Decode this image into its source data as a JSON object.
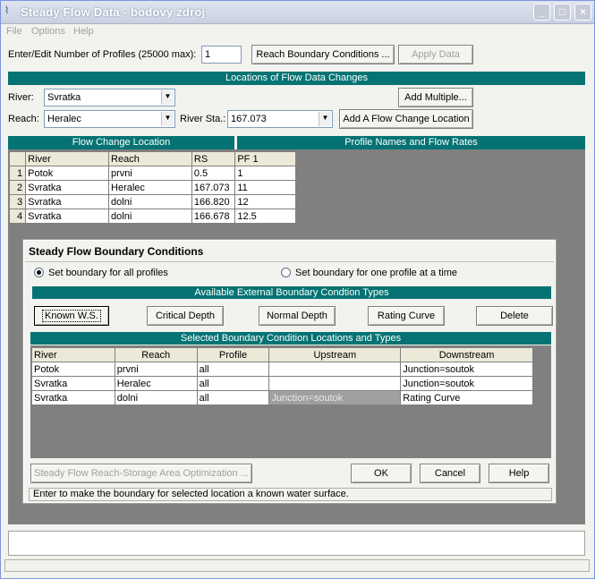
{
  "window": {
    "title": "Steady Flow Data - bodovy zdroj",
    "controls": {
      "minimize": "_",
      "maximize": "□",
      "close": "×"
    }
  },
  "menu": [
    "File",
    "Options",
    "Help"
  ],
  "top": {
    "profiles_label": "Enter/Edit Number of Profiles (25000 max):",
    "profiles_value": "1",
    "reach_bc_button": "Reach Boundary Conditions ...",
    "apply_button": "Apply Data"
  },
  "locations": {
    "band": "Locations of Flow Data Changes",
    "river_label": "River:",
    "river_value": "Svratka",
    "reach_label": "Reach:",
    "reach_value": "Heralec",
    "river_sta_label": "River Sta.:",
    "river_sta_value": "167.073",
    "add_multiple": "Add Multiple...",
    "add_location": "Add A Flow Change Location"
  },
  "flow_table": {
    "band_left": "Flow Change Location",
    "band_right": "Profile Names and Flow Rates",
    "headers": [
      "River",
      "Reach",
      "RS",
      "PF 1"
    ],
    "rows": [
      {
        "n": "1",
        "river": "Potok",
        "reach": "prvni",
        "rs": "0.5",
        "pf1": "1"
      },
      {
        "n": "2",
        "river": "Svratka",
        "reach": "Heralec",
        "rs": "167.073",
        "pf1": "11"
      },
      {
        "n": "3",
        "river": "Svratka",
        "reach": "dolni",
        "rs": "166.820",
        "pf1": "12"
      },
      {
        "n": "4",
        "river": "Svratka",
        "reach": "dolni",
        "rs": "166.678",
        "pf1": "12.5"
      }
    ]
  },
  "dialog": {
    "title": "Steady Flow Boundary Conditions",
    "radio_all": "Set boundary for all profiles",
    "radio_one": "Set boundary for one profile at a time",
    "types_band": "Available External Boundary Condtion Types",
    "type_buttons": [
      "Known W.S.",
      "Critical Depth",
      "Normal Depth",
      "Rating Curve",
      "Delete"
    ],
    "selected_band": "Selected Boundary Condition Locations and Types",
    "bc_headers": [
      "River",
      "Reach",
      "Profile",
      "Upstream",
      "Downstream"
    ],
    "bc_rows": [
      {
        "river": "Potok",
        "reach": "prvni",
        "profile": "all",
        "upstream": "",
        "downstream": "Junction=soutok"
      },
      {
        "river": "Svratka",
        "reach": "Heralec",
        "profile": "all",
        "upstream": "",
        "downstream": "Junction=soutok"
      },
      {
        "river": "Svratka",
        "reach": "dolni",
        "profile": "all",
        "upstream": "Junction=soutok",
        "downstream": "Rating Curve"
      }
    ],
    "optimization_button": "Steady Flow Reach-Storage Area Optimization ...",
    "ok": "OK",
    "cancel": "Cancel",
    "help": "Help",
    "status": "Enter to make the boundary for selected location a known water surface."
  },
  "colors": {
    "band": "#057373",
    "gray_pane": "#808080"
  }
}
